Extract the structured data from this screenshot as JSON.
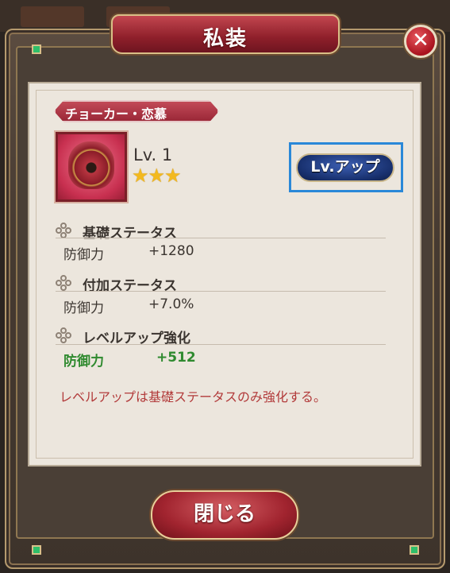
{
  "dialog": {
    "title": "私装",
    "close_icon": "close-icon",
    "close_button_label": "閉じる"
  },
  "item": {
    "name": "チョーカー・恋慕",
    "level": "Lv. 1",
    "stars": "★★★",
    "star_count": 3,
    "level_up_label": "Lv.アップ"
  },
  "sections": {
    "base": {
      "title": "基礎ステータス",
      "stat_label": "防御力",
      "stat_value": "+1280"
    },
    "extra": {
      "title": "付加ステータス",
      "stat_label": "防御力",
      "stat_value": "+7.0%"
    },
    "levelup": {
      "title": "レベルアップ強化",
      "stat_label": "防御力",
      "stat_value": "+512"
    }
  },
  "note": "レベルアップは基礎ステータスのみ強化する。",
  "colors": {
    "accent_red": "#9b2838",
    "button_blue": "#18306e",
    "highlight_outline": "#2a88d8",
    "bonus_green": "#2f8a2f",
    "note_red": "#b23a3a",
    "star_gold": "#f3b91e"
  }
}
